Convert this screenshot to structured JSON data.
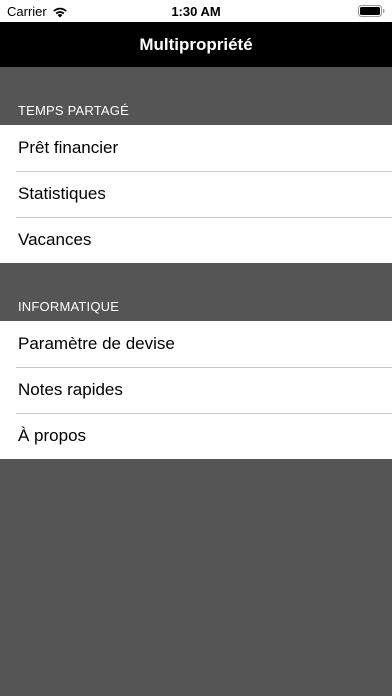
{
  "status_bar": {
    "carrier": "Carrier",
    "time": "1:30 AM",
    "icons": [
      "wifi-icon",
      "battery-icon"
    ]
  },
  "nav": {
    "title": "Multipropriété"
  },
  "sections": [
    {
      "header": "TEMPS PARTAGÉ",
      "items": [
        "Prêt financier",
        "Statistiques",
        "Vacances"
      ]
    },
    {
      "header": "INFORMATIQUE",
      "items": [
        "Paramètre de devise",
        "Notes rapides",
        "À propos"
      ]
    }
  ],
  "colors": {
    "background": "#555555",
    "nav_bar": "#000000",
    "row_background": "#ffffff",
    "separator": "#c8c7cc"
  }
}
